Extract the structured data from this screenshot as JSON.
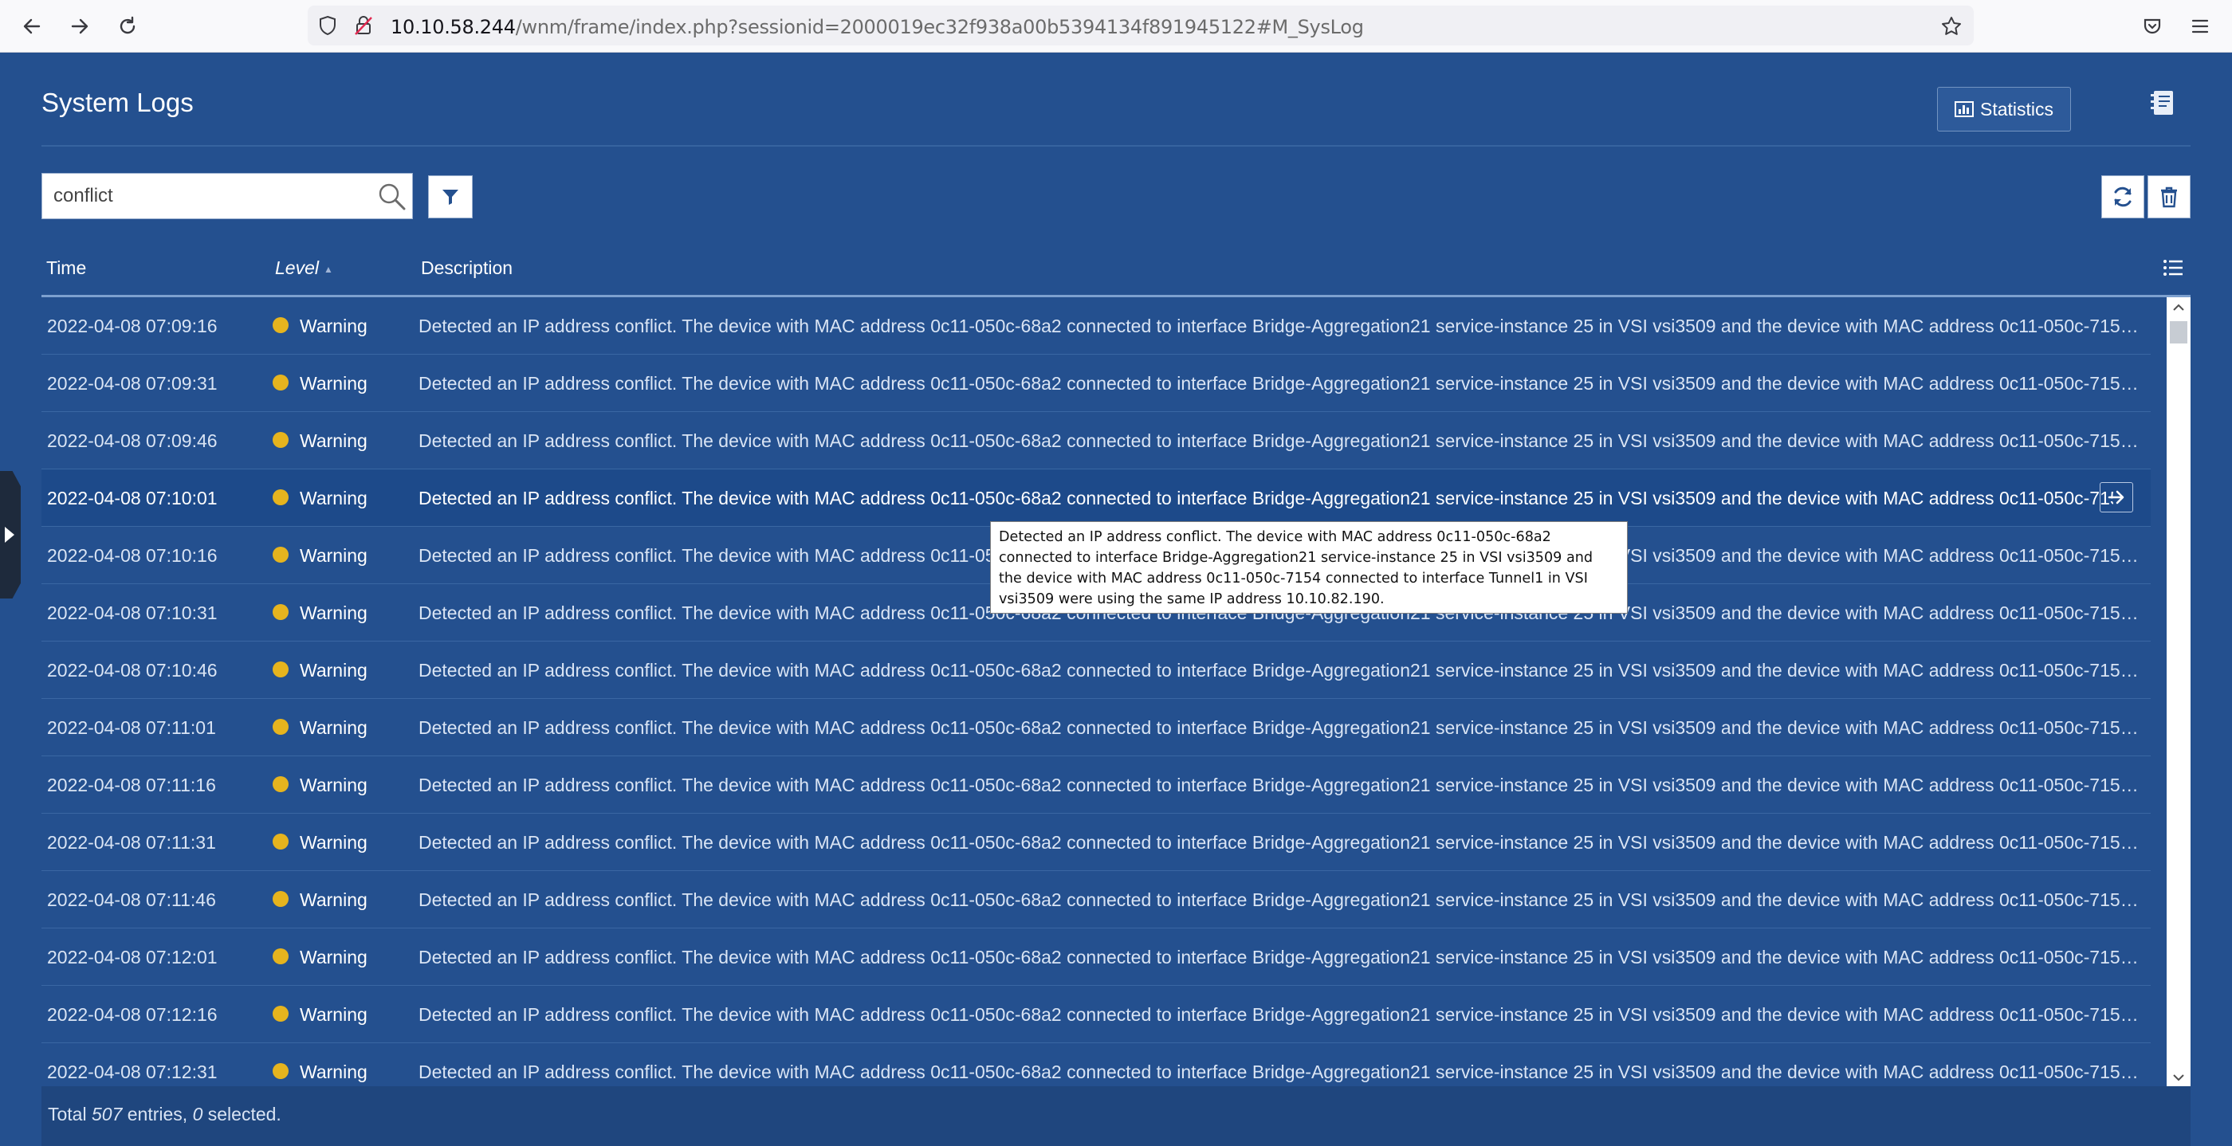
{
  "browser": {
    "url_host": "10.10.58.244",
    "url_path": "/wnm/frame/index.php?sessionid=2000019ec32f938a00b5394134f891945122#M_SysLog"
  },
  "page": {
    "title": "System Logs",
    "statistics_label": "Statistics"
  },
  "search": {
    "value": "conflict"
  },
  "table": {
    "headers": {
      "time": "Time",
      "level": "Level",
      "description": "Description"
    },
    "rows": [
      {
        "time": "2022-04-08 07:09:16",
        "level": "Warning",
        "description": "Detected an IP address conflict. The device with MAC address 0c11-050c-68a2 connected to interface Bridge-Aggregation21 service-instance 25 in VSI vsi3509 and the device with MAC address 0c11-050c-7154 connected to interface Tunnel1 in VSI vsi3509 were using the same IP address 10.10.82.190."
      },
      {
        "time": "2022-04-08 07:09:31",
        "level": "Warning",
        "description": "Detected an IP address conflict. The device with MAC address 0c11-050c-68a2 connected to interface Bridge-Aggregation21 service-instance 25 in VSI vsi3509 and the device with MAC address 0c11-050c-7154 connected to interface Tunnel1 in VSI vsi3509 were using the same IP address 10.10.82.190."
      },
      {
        "time": "2022-04-08 07:09:46",
        "level": "Warning",
        "description": "Detected an IP address conflict. The device with MAC address 0c11-050c-68a2 connected to interface Bridge-Aggregation21 service-instance 25 in VSI vsi3509 and the device with MAC address 0c11-050c-7154 connected to interface Tunnel1 in VSI vsi3509 were using the same IP address 10.10.82.190."
      },
      {
        "time": "2022-04-08 07:10:01",
        "level": "Warning",
        "description": "Detected an IP address conflict. The device with MAC address 0c11-050c-68a2 connected to interface Bridge-Aggregation21 service-instance 25 in VSI vsi3509 and the device with MAC address 0c11-050c-7154 connected to interface Tunnel1 in VSI vsi3509 were using the same IP address 10.10.82.190."
      },
      {
        "time": "2022-04-08 07:10:16",
        "level": "Warning",
        "description": "Detected an IP address conflict. The device with MAC address 0c11-050c-68a2 connected to interface Bridge-Aggregation21 service-instance 25 in VSI vsi3509 and the device with MAC address 0c11-050c-7154 connected to interface Tunnel1 in VSI vsi3509 were using the same IP address 10.10.82.190."
      },
      {
        "time": "2022-04-08 07:10:31",
        "level": "Warning",
        "description": "Detected an IP address conflict. The device with MAC address 0c11-050c-68a2 connected to interface Bridge-Aggregation21 service-instance 25 in VSI vsi3509 and the device with MAC address 0c11-050c-7154 connected to interface Tunnel1 in VSI vsi3509 were using the same IP address 10.10.82.190."
      },
      {
        "time": "2022-04-08 07:10:46",
        "level": "Warning",
        "description": "Detected an IP address conflict. The device with MAC address 0c11-050c-68a2 connected to interface Bridge-Aggregation21 service-instance 25 in VSI vsi3509 and the device with MAC address 0c11-050c-7154 connected to interface Tunnel1 in VSI vsi3509 were using the same IP address 10.10.82.190."
      },
      {
        "time": "2022-04-08 07:11:01",
        "level": "Warning",
        "description": "Detected an IP address conflict. The device with MAC address 0c11-050c-68a2 connected to interface Bridge-Aggregation21 service-instance 25 in VSI vsi3509 and the device with MAC address 0c11-050c-7154 connected to interface Tunnel1 in VSI vsi3509 were using the same IP address 10.10.82.190."
      },
      {
        "time": "2022-04-08 07:11:16",
        "level": "Warning",
        "description": "Detected an IP address conflict. The device with MAC address 0c11-050c-68a2 connected to interface Bridge-Aggregation21 service-instance 25 in VSI vsi3509 and the device with MAC address 0c11-050c-7154 connected to interface Tunnel1 in VSI vsi3509 were using the same IP address 10.10.82.190."
      },
      {
        "time": "2022-04-08 07:11:31",
        "level": "Warning",
        "description": "Detected an IP address conflict. The device with MAC address 0c11-050c-68a2 connected to interface Bridge-Aggregation21 service-instance 25 in VSI vsi3509 and the device with MAC address 0c11-050c-7154 connected to interface Tunnel1 in VSI vsi3509 were using the same IP address 10.10.82.190."
      },
      {
        "time": "2022-04-08 07:11:46",
        "level": "Warning",
        "description": "Detected an IP address conflict. The device with MAC address 0c11-050c-68a2 connected to interface Bridge-Aggregation21 service-instance 25 in VSI vsi3509 and the device with MAC address 0c11-050c-7154 connected to interface Tunnel1 in VSI vsi3509 were using the same IP address 10.10.82.190."
      },
      {
        "time": "2022-04-08 07:12:01",
        "level": "Warning",
        "description": "Detected an IP address conflict. The device with MAC address 0c11-050c-68a2 connected to interface Bridge-Aggregation21 service-instance 25 in VSI vsi3509 and the device with MAC address 0c11-050c-7154 connected to interface Tunnel1 in VSI vsi3509 were using the same IP address 10.10.82.190."
      },
      {
        "time": "2022-04-08 07:12:16",
        "level": "Warning",
        "description": "Detected an IP address conflict. The device with MAC address 0c11-050c-68a2 connected to interface Bridge-Aggregation21 service-instance 25 in VSI vsi3509 and the device with MAC address 0c11-050c-7154 connected to interface Tunnel1 in VSI vsi3509 were using the same IP address 10.10.82.190."
      },
      {
        "time": "2022-04-08 07:12:31",
        "level": "Warning",
        "description": "Detected an IP address conflict. The device with MAC address 0c11-050c-68a2 connected to interface Bridge-Aggregation21 service-instance 25 in VSI vsi3509 and the device with MAC address 0c11-050c-7154 connected to interface Tunnel1 in VSI vsi3509 were using the same IP address 10.10.82.190."
      }
    ]
  },
  "tooltip": {
    "text": "Detected an IP address conflict. The device with MAC address 0c11-050c-68a2 connected to interface Bridge-Aggregation21 service-instance 25 in VSI vsi3509 and the device with MAC address 0c11-050c-7154 connected to interface Tunnel1 in VSI vsi3509 were using the same IP address 10.10.82.190."
  },
  "footer": {
    "prefix": "Total ",
    "total": "507",
    "middle": " entries, ",
    "selected": "0",
    "suffix": " selected."
  },
  "colors": {
    "background": "#24508f",
    "header_line": "#7da0cf",
    "warning_dot": "#e6b41e",
    "footer": "#1f467e",
    "row_highlight": "#1d4a8a"
  },
  "icons": [
    "back-icon",
    "forward-icon",
    "reload-icon",
    "shield-icon",
    "insecure-lock-icon",
    "bookmark-star-icon",
    "pocket-icon",
    "menu-icon",
    "chart-icon",
    "notebook-icon",
    "search-icon",
    "filter-icon",
    "refresh-icon",
    "trash-icon",
    "column-list-icon",
    "arrow-right-icon",
    "scroll-up-icon",
    "scroll-down-icon"
  ]
}
